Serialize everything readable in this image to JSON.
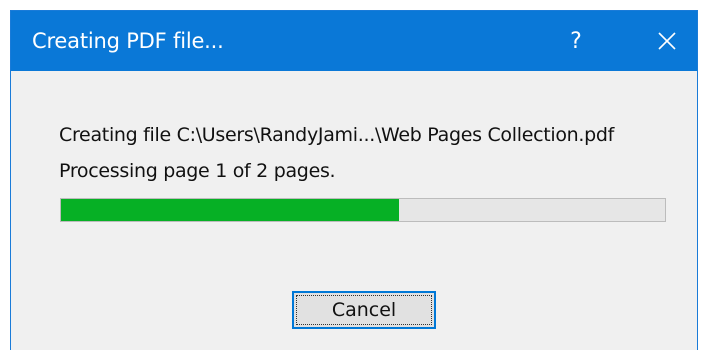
{
  "window": {
    "title": "Creating PDF file...",
    "help_label": "?",
    "titlebar_color": "#0a78d7"
  },
  "content": {
    "file_message": "Creating file C:\\Users\\RandyJami...\\Web Pages Collection.pdf",
    "progress_message": "Processing page 1 of 2 pages.",
    "progress": {
      "fraction": 0.56,
      "fill_color": "#06b025"
    }
  },
  "buttons": {
    "cancel_label": "Cancel"
  }
}
